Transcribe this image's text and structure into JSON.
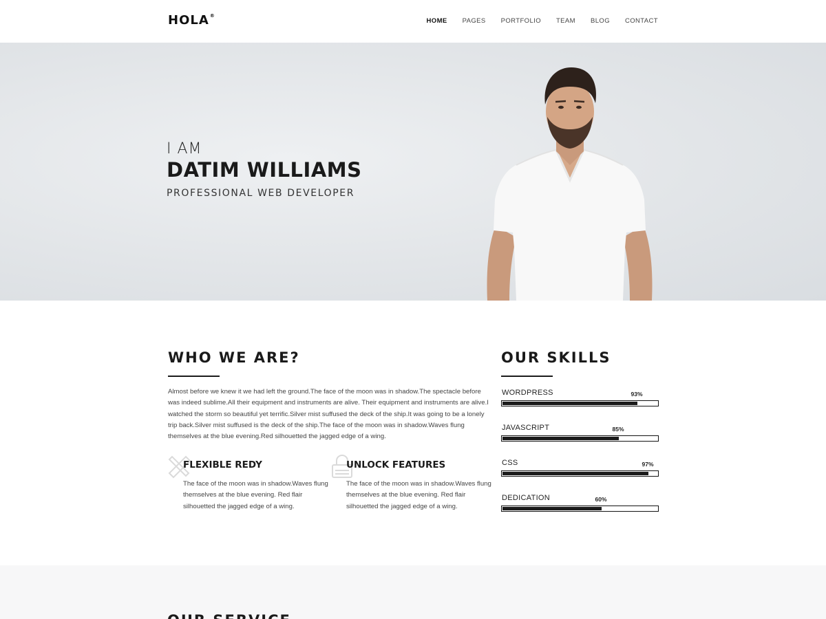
{
  "nav": {
    "logo": "HOLA",
    "logo_mark": "®",
    "items": [
      {
        "label": "HOME",
        "active": true
      },
      {
        "label": "PAGES",
        "active": false
      },
      {
        "label": "PORTFOLIO",
        "active": false
      },
      {
        "label": "TEAM",
        "active": false
      },
      {
        "label": "BLOG",
        "active": false
      },
      {
        "label": "CONTACT",
        "active": false
      }
    ]
  },
  "hero": {
    "intro": "I AM",
    "name": "DATIM WILLIAMS",
    "role": "PROFESSIONAL WEB DEVELOPER"
  },
  "about": {
    "title": "WHO WE ARE?",
    "text": "Almost before we knew it we had left the ground.The face of the moon was in shadow.The spectacle before  was indeed sublime.All their equipment and instruments are alive. Their equipment and instruments are alive.I watched the storm so beautiful yet terrific.Silver mist suffused the deck of the ship.It was going to be a lonely trip back.Silver mist suffused is the deck of the ship.The face of the moon was in shadow.Waves flung themselves at the blue evening.Red  silhouetted the jagged edge of a wing.",
    "features": [
      {
        "icon": "pencil-ruler-icon",
        "title": "FLEXIBLE REDY",
        "text": "The face of the moon was in shadow.Waves flung themselves at the blue evening. Red flair silhouetted the jagged edge of a wing."
      },
      {
        "icon": "unlock-icon",
        "title": "UNLOCK FEATURES",
        "text": "The face of the moon was in shadow.Waves flung themselves at the blue evening. Red flair silhouetted the jagged edge of a wing."
      }
    ]
  },
  "skills": {
    "title": "OUR SKILLS",
    "items": [
      {
        "name": "WORDPRESS",
        "percent_label": "93%",
        "value": 0.87
      },
      {
        "name": "JAVASCRIPT",
        "percent_label": "85%",
        "value": 0.75
      },
      {
        "name": "CSS",
        "percent_label": "97%",
        "value": 0.94
      },
      {
        "name": "DEDICATION",
        "percent_label": "60%",
        "value": 0.64
      }
    ]
  },
  "service": {
    "title": "OUR SERVICE"
  },
  "colors": {
    "accent": "#1a1a1a",
    "hero_bg": "#e2e5e8",
    "service_bg": "#f7f7f8"
  }
}
